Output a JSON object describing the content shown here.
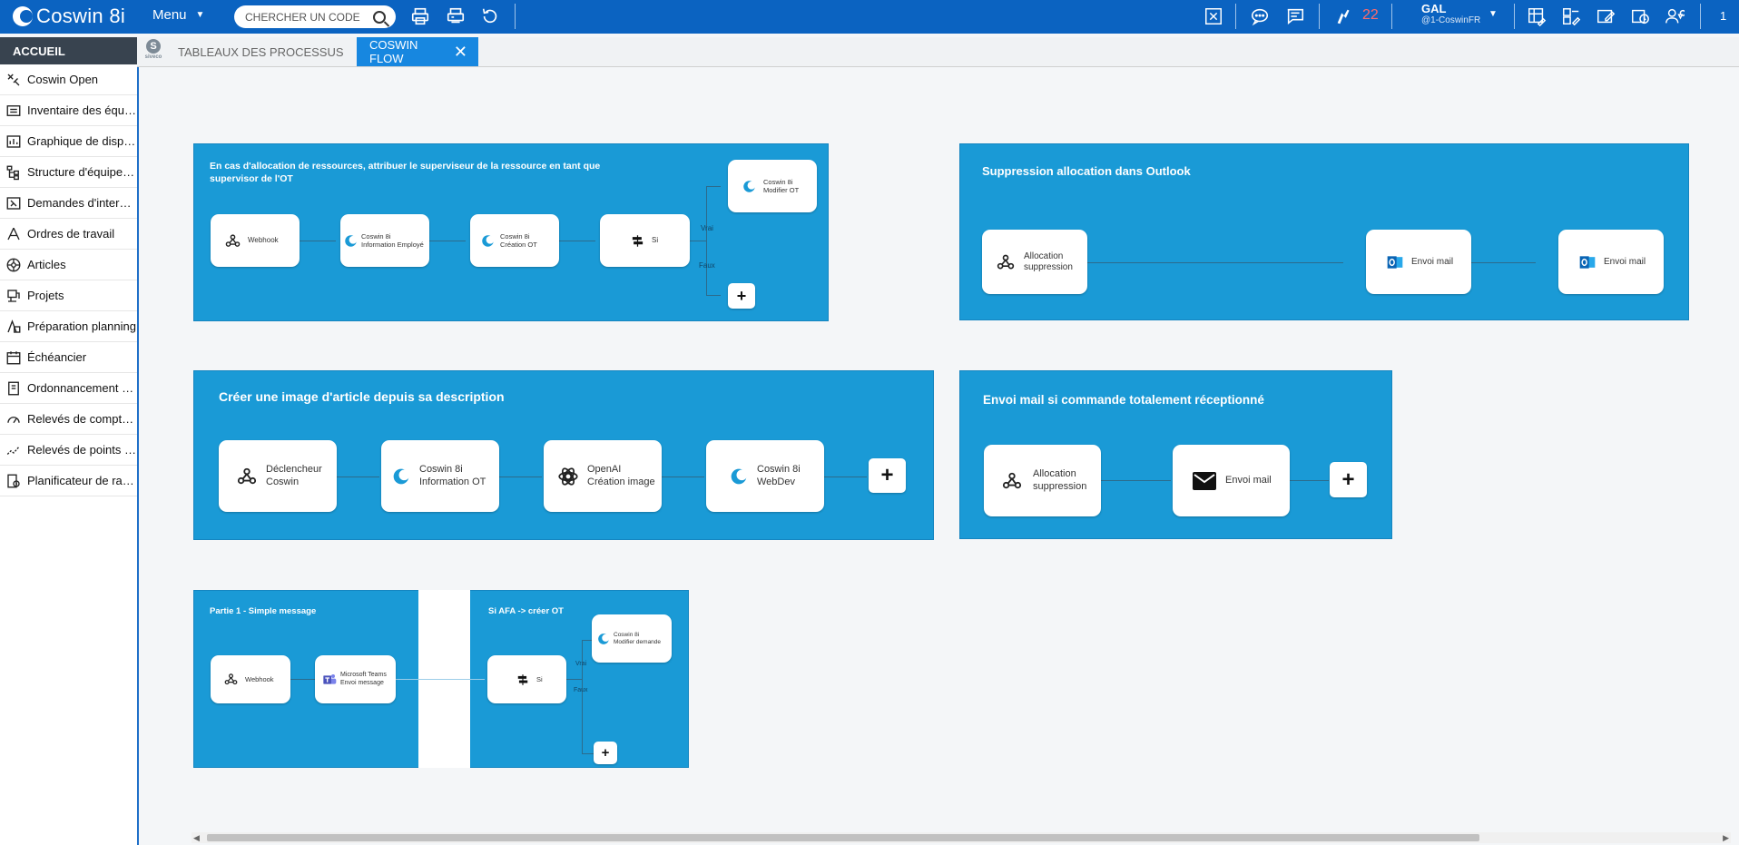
{
  "app": {
    "logo_text": "Coswin 8i",
    "menu_label": "Menu",
    "search_placeholder": "CHERCHER UN CODE",
    "notification_count": "22",
    "user_name": "GAL",
    "user_sub": "@1-CoswinFR",
    "page_indicator": "1"
  },
  "sidebar": {
    "home": "ACCUEIL",
    "items": [
      {
        "label": "Coswin Open",
        "icon": "tools-icon"
      },
      {
        "label": "Inventaire des équipements",
        "icon": "inventory-icon"
      },
      {
        "label": "Graphique de disponibilité",
        "icon": "chart-icon"
      },
      {
        "label": "Structure d'équipements",
        "icon": "tree-icon"
      },
      {
        "label": "Demandes d'intervention",
        "icon": "request-icon"
      },
      {
        "label": "Ordres de travail",
        "icon": "work-order-icon"
      },
      {
        "label": "Articles",
        "icon": "articles-icon"
      },
      {
        "label": "Projets",
        "icon": "projects-icon"
      },
      {
        "label": "Préparation planning",
        "icon": "planning-icon"
      },
      {
        "label": "Échéancier",
        "icon": "calendar-icon"
      },
      {
        "label": "Ordonnancement des travaux",
        "icon": "scheduling-icon"
      },
      {
        "label": "Relevés de compteurs",
        "icon": "gauge-icon"
      },
      {
        "label": "Relevés de points de mesure",
        "icon": "measure-icon"
      },
      {
        "label": "Planificateur de rapports",
        "icon": "report-planner-icon"
      }
    ]
  },
  "tabs": [
    {
      "label": "TABLEAUX DES PROCESSUS",
      "active": false
    },
    {
      "label": "COSWIN FLOW",
      "active": true
    }
  ],
  "brand": {
    "siveco_letter": "S",
    "siveco_text": "siveco"
  },
  "flows": {
    "f1": {
      "title": "En cas d'allocation de ressources, attribuer le superviseur de la ressource en tant que supervisor de l'OT",
      "nodes": [
        "Webhook",
        "Coswin 8i\nInformation Employé",
        "Coswin 8i\nCréation OT",
        "Si",
        "Coswin 8i\nModifier OT"
      ],
      "true_label": "Vrai",
      "false_label": "Faux"
    },
    "f2": {
      "title": "Suppression allocation dans Outlook",
      "nodes": [
        "Allocation\nsuppression",
        "Envoi mail",
        "Envoi mail"
      ]
    },
    "f3": {
      "title": "Créer une image d'article depuis sa description",
      "nodes": [
        "Déclencheur\nCoswin",
        "Coswin 8i\nInformation OT",
        "OpenAI\nCréation image",
        "Coswin 8i\nWebDev"
      ]
    },
    "f4": {
      "title": "Envoi mail si commande totalement réceptionné",
      "nodes": [
        "Allocation\nsuppression",
        "Envoi mail"
      ]
    },
    "f5": {
      "title": "Partie 1 - Simple message",
      "nodes": [
        "Webhook",
        "Microsoft Teams\nEnvoi message"
      ]
    },
    "f6": {
      "title": "Si AFA -> créer OT",
      "nodes": [
        "Si",
        "Coswin 8i\nModifier demande"
      ],
      "true_label": "Vrai",
      "false_label": "Faux"
    }
  },
  "colors": {
    "topbar": "#0b63c1",
    "panel": "#1a9ad6",
    "active_tab": "#1787e0",
    "notification": "#ff6b6b"
  }
}
